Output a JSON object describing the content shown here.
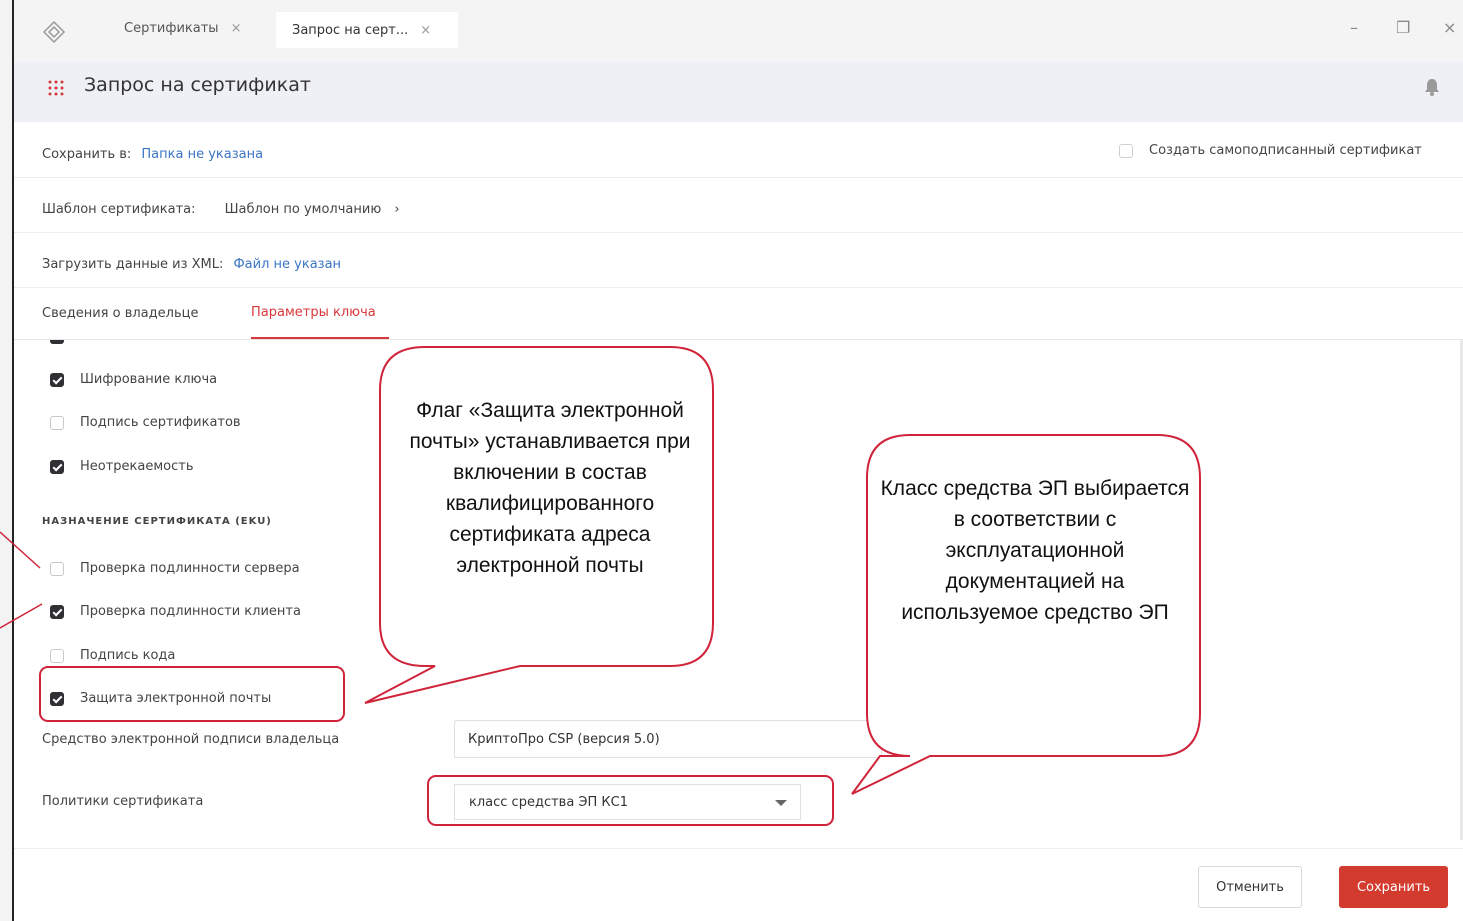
{
  "window": {
    "tabs": [
      {
        "label": "Сертификаты",
        "close": "×"
      },
      {
        "label": "Запрос на серт...",
        "close": "×"
      }
    ],
    "controls": {
      "minimize": "–",
      "restore": "❐",
      "close": "×"
    }
  },
  "header": {
    "title": "Запрос на сертификат"
  },
  "save_in": {
    "label": "Сохранить в:",
    "value": "Папка не указана"
  },
  "self_signed": {
    "label": "Создать самоподписанный сертификат",
    "checked": false
  },
  "template": {
    "label": "Шаблон сертификата:",
    "value": "Шаблон по умолчанию",
    "chevron": "›"
  },
  "xml": {
    "label": "Загрузить данные из XML:",
    "value": "Файл не указан"
  },
  "tabs": {
    "owner": "Сведения о владельце",
    "key_params": "Параметры ключа"
  },
  "key_usage": [
    {
      "label": "Шифрование ключа",
      "checked": true
    },
    {
      "label": "Подпись сертификатов",
      "checked": false
    },
    {
      "label": "Неотрекаемость",
      "checked": true
    }
  ],
  "eku": {
    "heading": "НАЗНАЧЕНИЕ СЕРТИФИКАТА (EKU)",
    "items": [
      {
        "label": "Проверка подлинности сервера",
        "checked": false
      },
      {
        "label": "Проверка подлинности клиента",
        "checked": true
      },
      {
        "label": "Подпись кода",
        "checked": false
      },
      {
        "label": "Защита электронной почты",
        "checked": true
      }
    ]
  },
  "sign_tool": {
    "label": "Средство электронной подписи владельца",
    "value": "КриптоПро CSP (версия 5.0)"
  },
  "policies": {
    "label": "Политики сертификата",
    "value": "класс средства ЭП КС1"
  },
  "buttons": {
    "cancel": "Отменить",
    "save": "Сохранить"
  },
  "callouts": {
    "email": "Флаг «Защита электронной почты» устанавливается при включении в состав квалифицированного сертификата адреса электронной почты",
    "class": "Класс средства ЭП выбирается в соответствии с эксплуатационной документацией на используемое средство ЭП"
  },
  "colors": {
    "accent": "#d9383a",
    "link": "#3a76c4",
    "save_button": "#d43b2f",
    "annotation": "#d0243a"
  }
}
